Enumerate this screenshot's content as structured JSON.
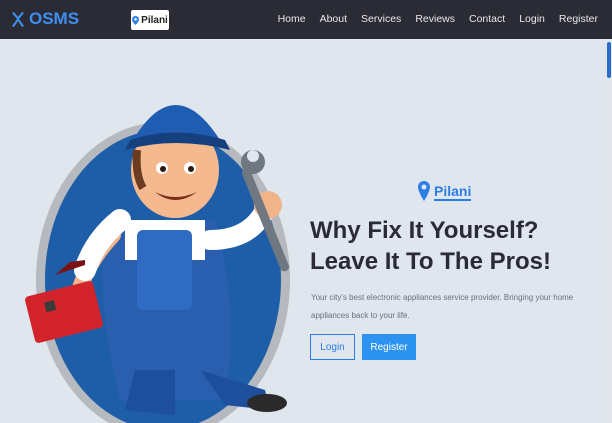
{
  "brand": {
    "name": "OSMS"
  },
  "location_pill": {
    "city": "Pilani"
  },
  "nav": {
    "items": [
      "Home",
      "About",
      "Services",
      "Reviews",
      "Contact",
      "Login",
      "Register"
    ]
  },
  "hero": {
    "city": "Pilani",
    "headline": "Why Fix It Yourself? Leave It To The Pros!",
    "subtext": "Your city's best electronic appliances service provider. Bringing your home appliances back to your life.",
    "login_label": "Login",
    "register_label": "Register"
  },
  "colors": {
    "nav_bg": "#2b2b36",
    "accent": "#2c7ee6",
    "page_bg": "#dfe6ee"
  },
  "icons": {
    "brand": "tools-icon",
    "location": "map-pin-icon"
  }
}
